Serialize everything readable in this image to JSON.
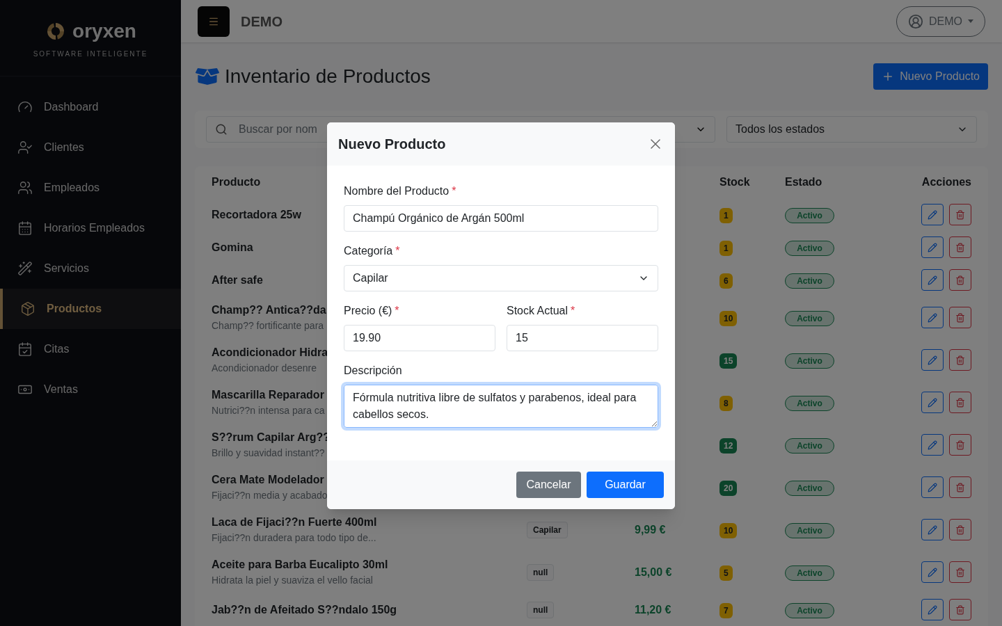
{
  "sidebar": {
    "brand": "oryxen",
    "tagline": "SOFTWARE INTELIGENTE",
    "items": [
      {
        "label": "Dashboard",
        "selected": false
      },
      {
        "label": "Clientes",
        "selected": false
      },
      {
        "label": "Empleados",
        "selected": false
      },
      {
        "label": "Horarios Empleados",
        "selected": false
      },
      {
        "label": "Servicios",
        "selected": false
      },
      {
        "label": "Productos",
        "selected": true
      },
      {
        "label": "Citas",
        "selected": false
      },
      {
        "label": "Ventas",
        "selected": false
      }
    ]
  },
  "header": {
    "title": "DEMO",
    "user": "DEMO"
  },
  "page": {
    "title": "Inventario de Productos",
    "new_button": "Nuevo Producto"
  },
  "filters": {
    "search_placeholder": "Buscar por nom",
    "status": "Todos los estados"
  },
  "table": {
    "columns": [
      {
        "label": "Producto"
      },
      {
        "label": "Stock"
      },
      {
        "label": "Estado"
      },
      {
        "label": "Acciones"
      }
    ],
    "rows": [
      {
        "name": "Recortadora 25w",
        "stock": "1",
        "stock_low": true,
        "status": "Activo"
      },
      {
        "name": "Gomina",
        "stock": "1",
        "stock_low": true,
        "status": "Activo"
      },
      {
        "name": "After safe",
        "stock": "6",
        "stock_low": true,
        "status": "Activo"
      },
      {
        "name": "Champ?? Antica??da",
        "description": "Champ?? fortificante para",
        "stock": "10",
        "stock_low": true,
        "status": "Activo"
      },
      {
        "name": "Acondicionador Hidra",
        "description": "Acondicionador desenre",
        "stock": "15",
        "stock_low": false,
        "status": "Activo"
      },
      {
        "name": "Mascarilla Reparador",
        "description": "Nutrici??n intensa para ca",
        "stock": "8",
        "stock_low": true,
        "status": "Activo"
      },
      {
        "name": "S??rum Capilar Arg??",
        "description": "Brillo y suavidad instant??",
        "stock": "12",
        "stock_low": false,
        "status": "Activo"
      },
      {
        "name": "Cera Mate Modelador",
        "description": "Fijaci??n media y acabado",
        "stock": "20",
        "stock_low": false,
        "status": "Activo"
      },
      {
        "name": "Laca de Fijaci??n Fuerte 400ml",
        "description": "Fijaci??n duradera para todo tipo de...",
        "category": "Capilar",
        "price": "9,99 €",
        "stock": "10",
        "stock_low": true,
        "status": "Activo"
      },
      {
        "name": "Aceite para Barba Eucalipto 30ml",
        "description": "Hidrata la piel y suaviza el vello facial",
        "category": "null",
        "price": "15,00 €",
        "stock": "5",
        "stock_low": true,
        "status": "Activo"
      },
      {
        "name": "Jab??n de Afeitado S??ndalo 150g",
        "category": "null",
        "price": "11,20 €",
        "stock": "7",
        "stock_low": true,
        "status": "Activo"
      }
    ]
  },
  "modal": {
    "title": "Nuevo Producto",
    "name": {
      "label": "Nombre del Producto",
      "required_mark": "*",
      "value": "Champú Orgánico de Argán 500ml"
    },
    "category": {
      "label": "Categoría",
      "required_mark": "*",
      "value": "Capilar"
    },
    "price": {
      "label": "Precio (€)",
      "required_mark": "*",
      "value": "19.90"
    },
    "stock": {
      "label": "Stock Actual",
      "required_mark": "*",
      "value": "15"
    },
    "description": {
      "label": "Descripción",
      "focused": true,
      "value": "Fórmula nutritiva libre de sulfatos y parabenos, ideal para cabellos secos."
    },
    "buttons": [
      {
        "label": "Cancelar",
        "kind": "secondary"
      },
      {
        "label": "Guardar",
        "kind": "primary"
      }
    ]
  }
}
